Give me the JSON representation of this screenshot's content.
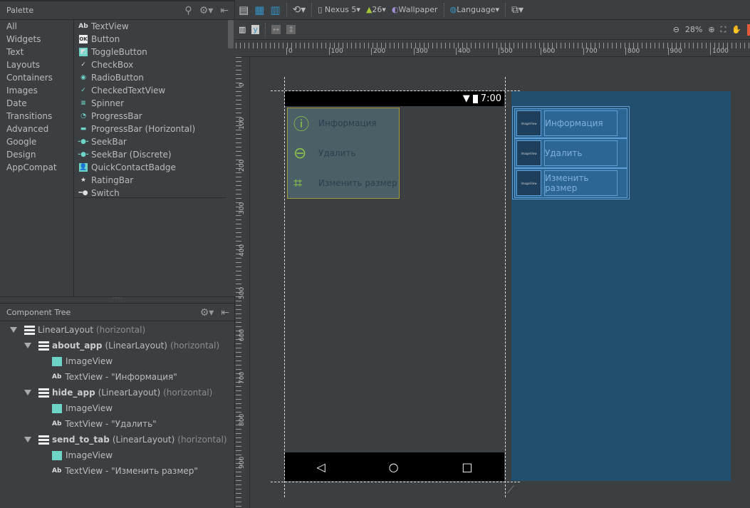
{
  "palette": {
    "title": "Palette",
    "categories": [
      "All",
      "Widgets",
      "Text",
      "Layouts",
      "Containers",
      "Images",
      "Date",
      "Transitions",
      "Advanced",
      "Google",
      "Design",
      "AppCompat"
    ],
    "items": [
      {
        "icon": "textview-icon",
        "label": "TextView"
      },
      {
        "icon": "button-icon",
        "label": "Button"
      },
      {
        "icon": "toggle-button-icon",
        "label": "ToggleButton"
      },
      {
        "icon": "checkbox-icon",
        "label": "CheckBox"
      },
      {
        "icon": "radio-button-icon",
        "label": "RadioButton"
      },
      {
        "icon": "checked-textview-icon",
        "label": "CheckedTextView"
      },
      {
        "icon": "spinner-icon",
        "label": "Spinner"
      },
      {
        "icon": "progressbar-icon",
        "label": "ProgressBar"
      },
      {
        "icon": "progressbar-horizontal-icon",
        "label": "ProgressBar (Horizontal)"
      },
      {
        "icon": "seekbar-icon",
        "label": "SeekBar"
      },
      {
        "icon": "seekbar-discrete-icon",
        "label": "SeekBar (Discrete)"
      },
      {
        "icon": "quick-contact-badge-icon",
        "label": "QuickContactBadge"
      },
      {
        "icon": "rating-bar-icon",
        "label": "RatingBar"
      },
      {
        "icon": "switch-icon",
        "label": "Switch"
      }
    ]
  },
  "tree": {
    "title": "Component Tree",
    "root": {
      "name": "LinearLayout",
      "suffix": "(horizontal)"
    },
    "groups": [
      {
        "id": "about_app",
        "type": "(LinearLayout)",
        "suffix": "(horizontal)",
        "image": "ImageView",
        "text": "TextView - \"Информация\""
      },
      {
        "id": "hide_app",
        "type": "(LinearLayout)",
        "suffix": "(horizontal)",
        "image": "ImageView",
        "text": "TextView - \"Удалить\""
      },
      {
        "id": "send_to_tab",
        "type": "(LinearLayout)",
        "suffix": "(horizontal)",
        "image": "ImageView",
        "text": "TextView - \"Изменить размер\""
      }
    ]
  },
  "toolbar": {
    "device": "Nexus 5",
    "api": "26",
    "theme": "Wallpaper",
    "language": "Language",
    "zoom": "28%"
  },
  "ruler": {
    "x": [
      "0",
      "100",
      "200",
      "300",
      "400",
      "500",
      "600",
      "700",
      "800",
      "900",
      "1000"
    ],
    "y": [
      "0",
      "100",
      "200",
      "300",
      "400",
      "500",
      "600",
      "700",
      "800",
      "900"
    ]
  },
  "device": {
    "time": "7:00",
    "menu": [
      {
        "icon": "info-icon",
        "label": "Информация"
      },
      {
        "icon": "minus-circle-icon",
        "label": "Удалить"
      },
      {
        "icon": "crop-icon",
        "label": "Изменить размер"
      }
    ],
    "image_placeholder": "ImageView"
  },
  "colors": {
    "accent": "#8bc34a",
    "blueprint": "#224f70",
    "selection": "#a09a3a"
  }
}
